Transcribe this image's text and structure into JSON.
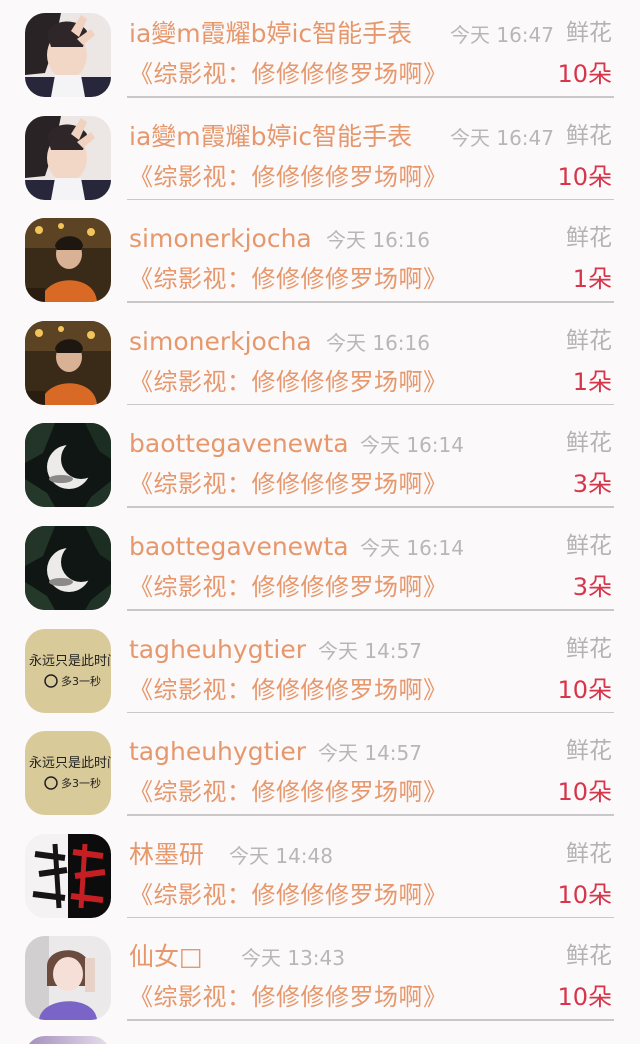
{
  "colors": {
    "background": "#fbf9fa",
    "name": "#e6986c",
    "time": "#b8b6b7",
    "count": "#d7354a",
    "divider": "#c9c7c8"
  },
  "rows": [
    {
      "name": "ia變m霞耀b婷ic智能手表",
      "time": "今天 16:47",
      "gift": "鲜花",
      "title": "《综影视：修修修修罗场啊》",
      "count": "10朵",
      "avatar": "girl-peace-sign-avatar"
    },
    {
      "name": "ia變m霞耀b婷ic智能手表",
      "time": "今天 16:47",
      "gift": "鲜花",
      "title": "《综影视：修修修修罗场啊》",
      "count": "10朵",
      "avatar": "girl-peace-sign-avatar"
    },
    {
      "name": "simonerkjocha",
      "time": "今天 16:16",
      "gift": "鲜花",
      "title": "《综影视：修修修修罗场啊》",
      "count": "1朵",
      "avatar": "boy-orange-sweater-avatar"
    },
    {
      "name": "simonerkjocha",
      "time": "今天 16:16",
      "gift": "鲜花",
      "title": "《综影视：修修修修罗场啊》",
      "count": "1朵",
      "avatar": "boy-orange-sweater-avatar"
    },
    {
      "name": "baottegavenewta",
      "time": "今天 16:14",
      "gift": "鲜花",
      "title": "《综影视：修修修修罗场啊》",
      "count": "3朵",
      "avatar": "crescent-moon-avatar"
    },
    {
      "name": "baottegavenewta",
      "time": "今天 16:14",
      "gift": "鲜花",
      "title": "《综影视：修修修修罗场啊》",
      "count": "3朵",
      "avatar": "crescent-moon-avatar"
    },
    {
      "name": "tagheuhygtier",
      "time": "今天 14:57",
      "gift": "鲜花",
      "title": "《综影视：修修修修罗场啊》",
      "count": "10朵",
      "avatar": "handwriting-note-avatar"
    },
    {
      "name": "tagheuhygtier",
      "time": "今天 14:57",
      "gift": "鲜花",
      "title": "《综影视：修修修修罗场啊》",
      "count": "10朵",
      "avatar": "handwriting-note-avatar"
    },
    {
      "name": "林墨研",
      "time": "今天 14:48",
      "gift": "鲜花",
      "title": "《综影视：修修修修罗场啊》",
      "count": "10朵",
      "avatar": "calligraphy-avatar"
    },
    {
      "name": "仙女□",
      "time": "今天 13:43",
      "gift": "鲜花",
      "title": "《综影视：修修修修罗场啊》",
      "count": "10朵",
      "avatar": "girl-selfie-avatar"
    }
  ]
}
